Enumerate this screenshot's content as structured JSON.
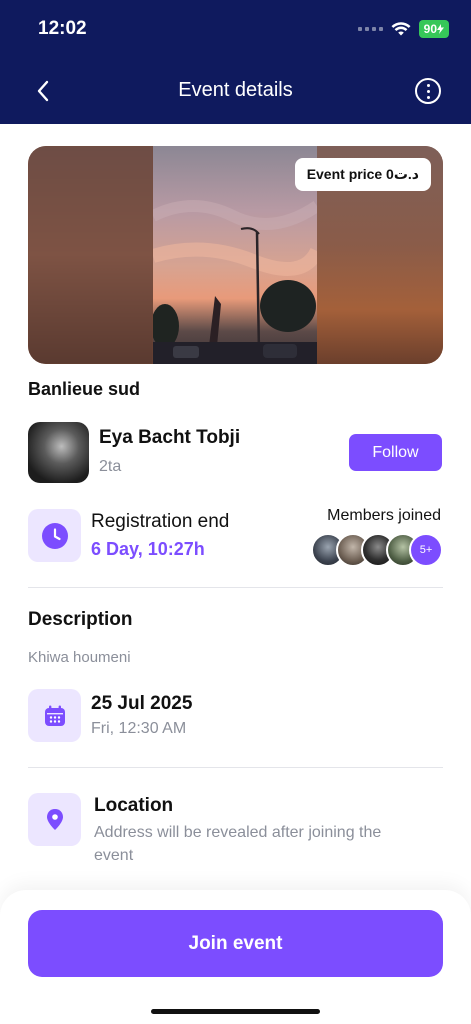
{
  "status_bar": {
    "time": "12:02",
    "battery": "90"
  },
  "header": {
    "title": "Event details"
  },
  "hero": {
    "price_badge": "Event price 0د.ت"
  },
  "event": {
    "place": "Banlieue sud"
  },
  "organizer": {
    "name": "Eya Bacht Tobji",
    "handle": "2ta",
    "follow_label": "Follow"
  },
  "registration": {
    "label": "Registration end",
    "value": "6 Day, 10:27h"
  },
  "members": {
    "label": "Members joined",
    "more": "5+"
  },
  "description": {
    "title": "Description",
    "text": "Khiwa houmeni"
  },
  "date": {
    "main": "25 Jul 2025",
    "sub": "Fri, 12:30 AM"
  },
  "location": {
    "title": "Location",
    "text": "Address will be revealed after joining the event"
  },
  "actions": {
    "join_label": "Join event"
  },
  "colors": {
    "accent": "#7c4dff",
    "header_bg": "#0f1a5e",
    "tile_bg": "#ece6ff"
  }
}
